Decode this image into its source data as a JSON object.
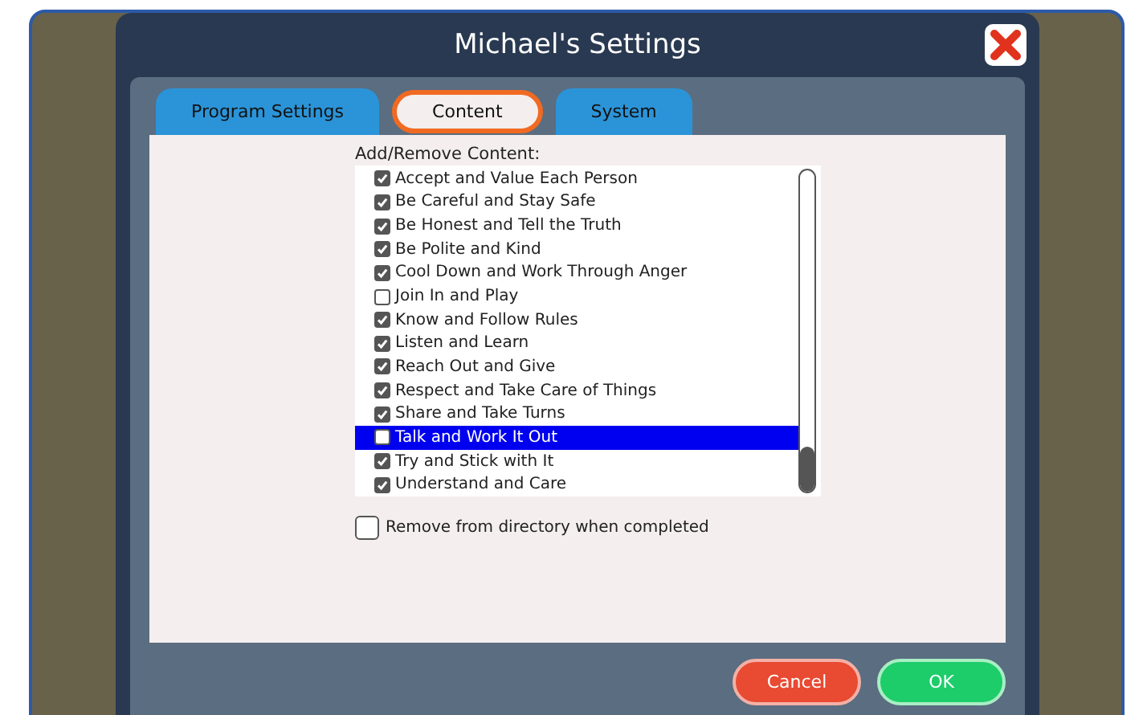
{
  "window": {
    "title": "Michael's Settings"
  },
  "tabs": [
    {
      "label": "Program Settings",
      "selected": false
    },
    {
      "label": "Content",
      "selected": true
    },
    {
      "label": "System",
      "selected": false
    }
  ],
  "content": {
    "heading": "Add/Remove Content:",
    "items": [
      {
        "label": "Accept and Value Each Person",
        "checked": true,
        "selected": false
      },
      {
        "label": "Be Careful and Stay Safe",
        "checked": true,
        "selected": false
      },
      {
        "label": "Be Honest and Tell the Truth",
        "checked": true,
        "selected": false
      },
      {
        "label": "Be Polite and Kind",
        "checked": true,
        "selected": false
      },
      {
        "label": "Cool Down and Work Through Anger",
        "checked": true,
        "selected": false
      },
      {
        "label": "Join In and Play",
        "checked": false,
        "selected": false
      },
      {
        "label": "Know and Follow Rules",
        "checked": true,
        "selected": false
      },
      {
        "label": "Listen and Learn",
        "checked": true,
        "selected": false
      },
      {
        "label": "Reach Out and Give",
        "checked": true,
        "selected": false
      },
      {
        "label": "Respect and Take Care of Things",
        "checked": true,
        "selected": false
      },
      {
        "label": "Share and Take Turns",
        "checked": true,
        "selected": false
      },
      {
        "label": "Talk and Work It Out",
        "checked": false,
        "selected": true
      },
      {
        "label": "Try and Stick with It",
        "checked": true,
        "selected": false
      },
      {
        "label": "Understand and Care",
        "checked": true,
        "selected": false
      }
    ],
    "remove_option": {
      "label": "Remove from directory when completed",
      "checked": false
    }
  },
  "buttons": [
    {
      "label": "Cancel",
      "kind": "cancel"
    },
    {
      "label": "OK",
      "kind": "ok"
    }
  ]
}
